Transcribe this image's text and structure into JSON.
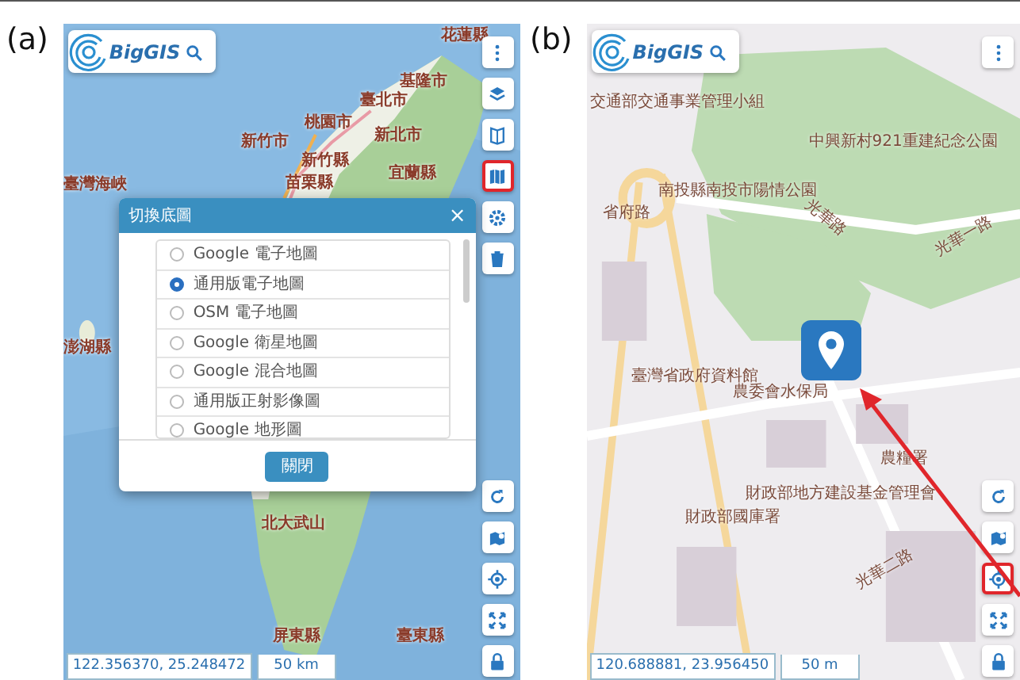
{
  "panels": [
    {
      "label": "(a)",
      "brand": "BigGIS",
      "map_labels": [
        "花蓮縣",
        "基隆市",
        "臺北市",
        "桃園市",
        "新北市",
        "新竹市",
        "新竹縣",
        "宜蘭縣",
        "苗栗縣",
        "臺灣海峽",
        "澎湖縣",
        "北大武山",
        "屏東縣",
        "臺東縣"
      ],
      "top_tools": [
        {
          "kind": "menu",
          "highlighted": false
        },
        {
          "kind": "layers",
          "highlighted": false
        },
        {
          "kind": "measure",
          "highlighted": false
        },
        {
          "kind": "basemap",
          "highlighted": true
        },
        {
          "kind": "settings",
          "highlighted": false
        },
        {
          "kind": "delete",
          "highlighted": false
        }
      ],
      "bottom_tools": [
        {
          "kind": "refresh",
          "highlighted": false
        },
        {
          "kind": "route",
          "highlighted": false
        },
        {
          "kind": "locate",
          "highlighted": false
        },
        {
          "kind": "fullscreen",
          "highlighted": false
        },
        {
          "kind": "lock",
          "highlighted": false
        }
      ],
      "dialog": {
        "title": "切換底圖",
        "close": "×",
        "options": [
          {
            "label": "Google 電子地圖",
            "selected": false
          },
          {
            "label": "通用版電子地圖",
            "selected": true
          },
          {
            "label": "OSM 電子地圖",
            "selected": false
          },
          {
            "label": "Google 衛星地圖",
            "selected": false
          },
          {
            "label": "Google 混合地圖",
            "selected": false
          },
          {
            "label": "通用版正射影像圖",
            "selected": false
          },
          {
            "label": "Google 地形圖",
            "selected": false
          }
        ],
        "button": "關閉"
      },
      "pin": false,
      "coordinates": "122.356370, 25.248472",
      "scale": "50 km"
    },
    {
      "label": "(b)",
      "brand": "BigGIS",
      "map_labels": [
        "交通部交通事業管理小組",
        "中興新村921重建紀念公園",
        "南投縣南投市陽情公園",
        "省府路",
        "光華路",
        "光華一路",
        "臺灣省政府資料館",
        "農委會水保局",
        "農糧署",
        "財政部地方建設基金管理會",
        "財政部國庫署",
        "光華二路"
      ],
      "top_tools": [
        {
          "kind": "menu",
          "highlighted": false
        }
      ],
      "bottom_tools": [
        {
          "kind": "refresh",
          "highlighted": false
        },
        {
          "kind": "route",
          "highlighted": false
        },
        {
          "kind": "locate",
          "highlighted": true
        },
        {
          "kind": "fullscreen",
          "highlighted": false
        },
        {
          "kind": "lock",
          "highlighted": false
        }
      ],
      "pin": true,
      "coordinates": "120.688881, 23.956450",
      "scale": "50 m"
    }
  ]
}
